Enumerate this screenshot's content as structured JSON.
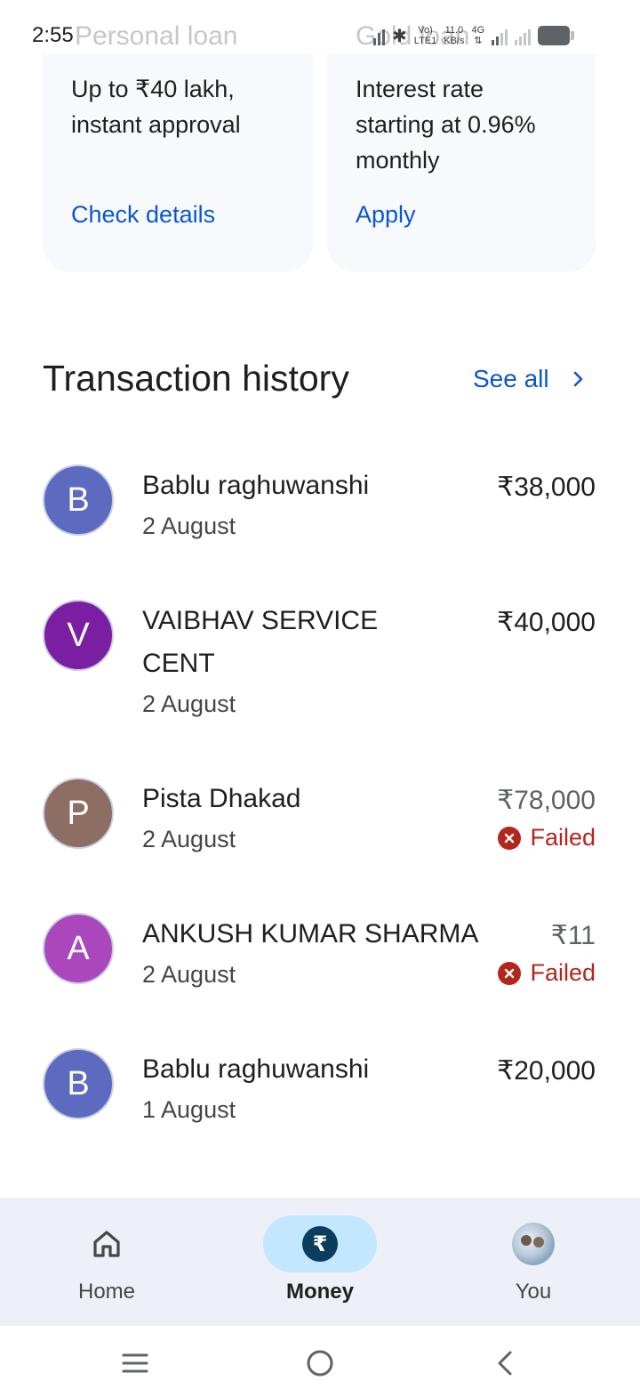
{
  "status_bar": {
    "time": "2:55",
    "network_speed": "11.0",
    "network_unit": "KB/s",
    "volte": "Vo)",
    "lte": "LTE1",
    "net_type": "4G"
  },
  "ghost_titles": {
    "left": "Personal loan",
    "right": "Gold loan"
  },
  "loan_cards": [
    {
      "text": "Up to ₹40 lakh, instant approval",
      "link": "Check details"
    },
    {
      "text": "Interest rate starting at 0.96% monthly",
      "link": "Apply"
    }
  ],
  "transactions": {
    "title": "Transaction history",
    "see_all": "See all",
    "items": [
      {
        "initial": "B",
        "name": "Bablu raghuwanshi",
        "date": "2 August",
        "amount": "₹38,000",
        "status": "",
        "color": "#5c6bc0"
      },
      {
        "initial": "V",
        "name": "VAIBHAV SERVICE CENT",
        "date": "2 August",
        "amount": "₹40,000",
        "status": "",
        "color": "#7b1fa2"
      },
      {
        "initial": "P",
        "name": "Pista Dhakad",
        "date": "2 August",
        "amount": "₹78,000",
        "status": "Failed",
        "color": "#8d6e63"
      },
      {
        "initial": "A",
        "name": "ANKUSH KUMAR SHARMA",
        "date": "2 August",
        "amount": "₹11",
        "status": "Failed",
        "color": "#ab47bc"
      },
      {
        "initial": "B",
        "name": "Bablu raghuwanshi",
        "date": "1 August",
        "amount": "₹20,000",
        "status": "",
        "color": "#5c6bc0"
      }
    ]
  },
  "bottom_nav": {
    "home": "Home",
    "money": "Money",
    "money_symbol": "₹",
    "you": "You"
  },
  "colors": {
    "accent": "#0b57d0",
    "failed": "#b3261e",
    "nav_active_pill": "#c2e7ff"
  }
}
